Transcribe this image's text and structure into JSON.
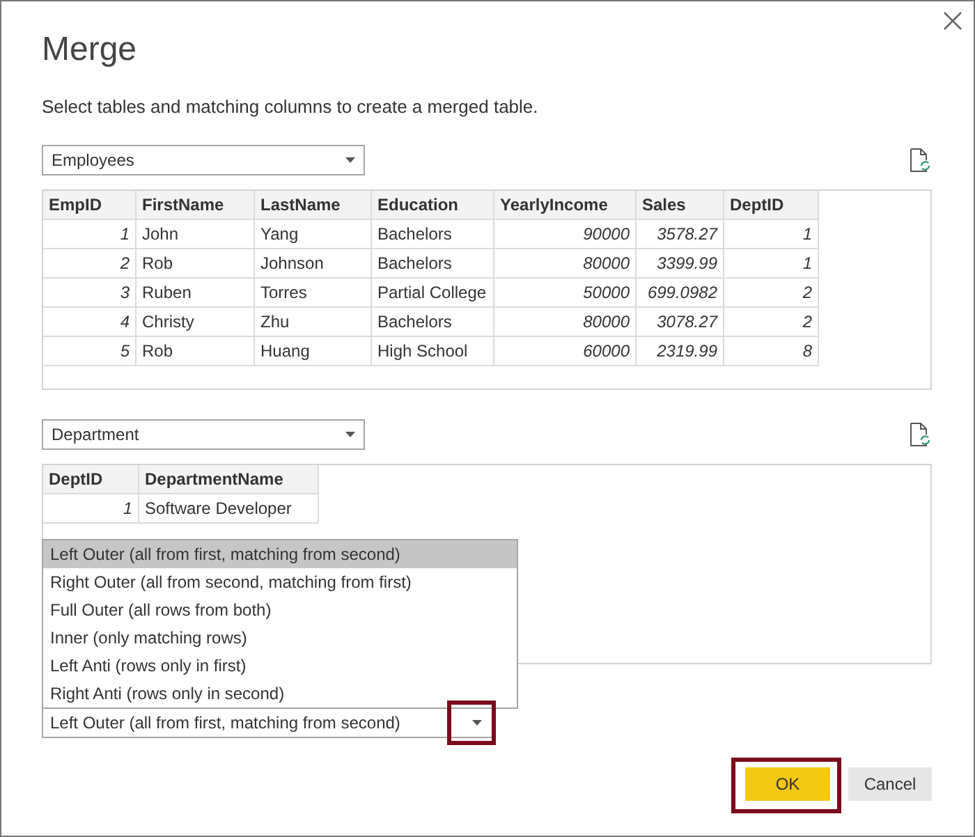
{
  "dialog": {
    "title": "Merge",
    "instruction": "Select tables and matching columns to create a merged table."
  },
  "first_table": {
    "selector": "Employees",
    "columns": [
      {
        "label": "EmpID",
        "numeric": true
      },
      {
        "label": "FirstName",
        "numeric": false
      },
      {
        "label": "LastName",
        "numeric": false
      },
      {
        "label": "Education",
        "numeric": false
      },
      {
        "label": "YearlyIncome",
        "numeric": true
      },
      {
        "label": "Sales",
        "numeric": true
      },
      {
        "label": "DeptID",
        "numeric": true
      }
    ],
    "rows": [
      [
        "1",
        "John",
        "Yang",
        "Bachelors",
        "90000",
        "3578.27",
        "1"
      ],
      [
        "2",
        "Rob",
        "Johnson",
        "Bachelors",
        "80000",
        "3399.99",
        "1"
      ],
      [
        "3",
        "Ruben",
        "Torres",
        "Partial College",
        "50000",
        "699.0982",
        "2"
      ],
      [
        "4",
        "Christy",
        "Zhu",
        "Bachelors",
        "80000",
        "3078.27",
        "2"
      ],
      [
        "5",
        "Rob",
        "Huang",
        "High School",
        "60000",
        "2319.99",
        "8"
      ]
    ]
  },
  "second_table": {
    "selector": "Department",
    "columns": [
      {
        "label": "DeptID",
        "numeric": true
      },
      {
        "label": "DepartmentName",
        "numeric": false
      }
    ],
    "rows": [
      [
        "1",
        "Software Developer"
      ]
    ]
  },
  "join_kind": {
    "value": "Left Outer (all from first, matching from second)",
    "expanded": true,
    "arrow_highlighted": true,
    "options": [
      {
        "label": "Left Outer (all from first, matching from second)",
        "selected": true
      },
      {
        "label": "Right Outer (all from second, matching from first)",
        "selected": false
      },
      {
        "label": "Full Outer (all rows from both)",
        "selected": false
      },
      {
        "label": "Inner (only matching rows)",
        "selected": false
      },
      {
        "label": "Left Anti (rows only in first)",
        "selected": false
      },
      {
        "label": "Right Anti (rows only in second)",
        "selected": false
      }
    ]
  },
  "buttons": [
    {
      "label": "OK",
      "kind": "primary",
      "highlighted": true
    },
    {
      "label": "Cancel",
      "kind": "secondary",
      "highlighted": false
    }
  ]
}
